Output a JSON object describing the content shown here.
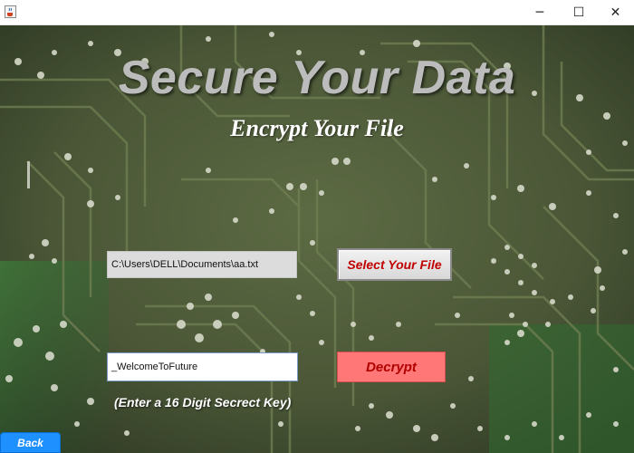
{
  "window": {
    "app_icon": "java-coffee-icon",
    "controls": {
      "minimize": "─",
      "maximize": "☐",
      "close": "✕"
    }
  },
  "main": {
    "title": "Secure Your Data",
    "subtitle": "Encrypt Your File",
    "file_path_value": "C:\\Users\\DELL\\Documents\\aa.txt",
    "select_file_label": "Select Your File",
    "key_value": "_WelcomeToFuture",
    "decrypt_label": "Decrypt",
    "key_hint": "(Enter a 16 Digit Secrect Key)",
    "back_label": "Back"
  },
  "colors": {
    "title_text": "#bcbcbc",
    "select_text": "#c00000",
    "decrypt_bg": "#ff7777",
    "back_bg": "#1e90ff",
    "circuit_board": "#4e5b3a"
  }
}
